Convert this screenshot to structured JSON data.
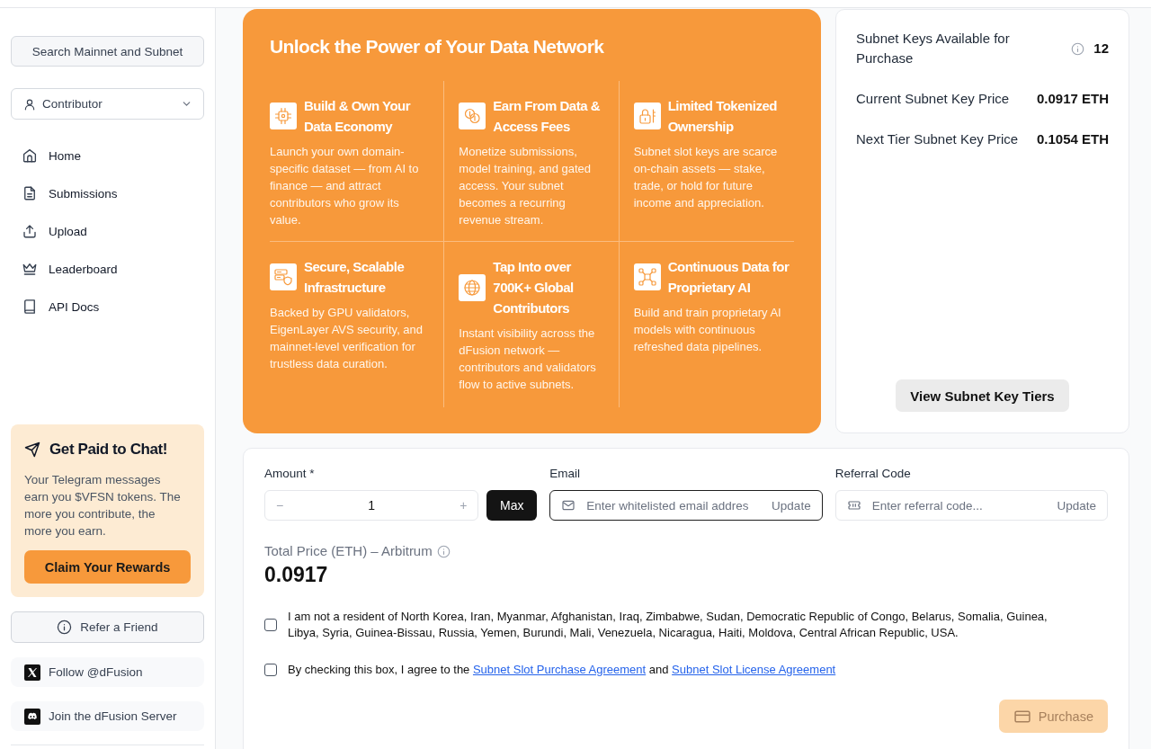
{
  "sidebar": {
    "search_button": "Search Mainnet and Subnet",
    "role_select": {
      "value": "Contributor"
    },
    "nav_items": [
      {
        "label": "Home"
      },
      {
        "label": "Submissions"
      },
      {
        "label": "Upload"
      },
      {
        "label": "Leaderboard"
      },
      {
        "label": "API Docs"
      }
    ],
    "promo": {
      "title": "Get Paid to Chat!",
      "text": "Your Telegram messages earn you $VFSN tokens. The more you contribute, the more you earn.",
      "button": "Claim Your Rewards"
    },
    "refer_button": "Refer a Friend",
    "social_links": [
      {
        "label": "Follow @dFusion"
      },
      {
        "label": "Join the dFusion Server"
      }
    ]
  },
  "hero": {
    "title": "Unlock the Power of Your Data Network",
    "features": [
      {
        "title": "Build & Own Your Data Economy",
        "description": "Launch your own domain-specific dataset — from AI to finance — and attract contributors who grow its value."
      },
      {
        "title": "Earn From Data & Access Fees",
        "description": "Monetize submissions, model training, and gated access. Your subnet becomes a recurring revenue stream."
      },
      {
        "title": "Limited Tokenized Ownership",
        "description": "Subnet slot keys are scarce on-chain assets — stake, trade, or hold for future income and appreciation."
      },
      {
        "title": "Secure, Scalable Infrastructure",
        "description": "Backed by GPU validators, EigenLayer AVS security, and mainnet-level verification for trustless data curation."
      },
      {
        "title": "Tap Into over 700K+ Global Contributors",
        "description": "Instant visibility across the dFusion network — contributors and validators flow to active subnets."
      },
      {
        "title": "Continuous Data for Proprietary AI",
        "description": "Build and train proprietary AI models with continuous refreshed data pipelines."
      }
    ]
  },
  "stats": {
    "rows": [
      {
        "label": "Subnet Keys Available for Purchase",
        "value": "12",
        "info": true
      },
      {
        "label": "Current Subnet Key Price",
        "value": "0.0917 ETH",
        "info": false
      },
      {
        "label": "Next Tier Subnet Key Price",
        "value": "0.1054 ETH",
        "info": false
      }
    ],
    "button": "View Subnet Key Tiers"
  },
  "purchase_form": {
    "amount": {
      "label": "Amount *",
      "decrement": "−",
      "value": "1",
      "increment": "+",
      "max_button": "Max"
    },
    "email": {
      "label": "Email",
      "placeholder": "Enter whitelisted email addres",
      "button": "Update",
      "focused": true
    },
    "referral": {
      "label": "Referral Code",
      "placeholder": "Enter referral code...",
      "button": "Update",
      "focused": false
    },
    "total": {
      "label": "Total Price (ETH) – Arbitrum",
      "value": "0.0917"
    },
    "agreements": [
      {
        "checked": false,
        "parts": [
          {
            "text": "I am not a resident of North Korea, Iran, Myanmar, Afghanistan, Iraq, Zimbabwe, Sudan, Democratic Republic of Congo, Belarus, Somalia, Guinea, Libya, Syria, Guinea-Bissau, Russia, Yemen, Burundi, Mali, Venezuela, Nicaragua, Haiti, Moldova, Central African Republic, USA."
          }
        ]
      },
      {
        "checked": false,
        "parts": [
          {
            "text": "By checking this box, I agree to the "
          },
          {
            "link": "Subnet Slot Purchase Agreement"
          },
          {
            "text": " and "
          },
          {
            "link": "Subnet Slot License Agreement"
          }
        ]
      }
    ],
    "purchase_button": {
      "label": "Purchase",
      "disabled": true
    }
  }
}
